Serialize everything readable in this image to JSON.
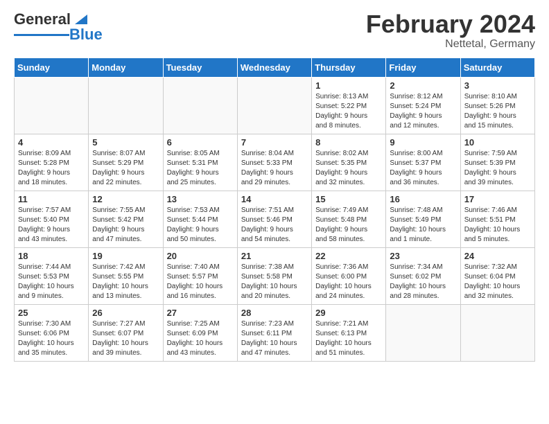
{
  "header": {
    "logo_general": "General",
    "logo_blue": "Blue",
    "month_title": "February 2024",
    "location": "Nettetal, Germany"
  },
  "days_of_week": [
    "Sunday",
    "Monday",
    "Tuesday",
    "Wednesday",
    "Thursday",
    "Friday",
    "Saturday"
  ],
  "weeks": [
    [
      {
        "day": "",
        "info": ""
      },
      {
        "day": "",
        "info": ""
      },
      {
        "day": "",
        "info": ""
      },
      {
        "day": "",
        "info": ""
      },
      {
        "day": "1",
        "info": "Sunrise: 8:13 AM\nSunset: 5:22 PM\nDaylight: 9 hours\nand 8 minutes."
      },
      {
        "day": "2",
        "info": "Sunrise: 8:12 AM\nSunset: 5:24 PM\nDaylight: 9 hours\nand 12 minutes."
      },
      {
        "day": "3",
        "info": "Sunrise: 8:10 AM\nSunset: 5:26 PM\nDaylight: 9 hours\nand 15 minutes."
      }
    ],
    [
      {
        "day": "4",
        "info": "Sunrise: 8:09 AM\nSunset: 5:28 PM\nDaylight: 9 hours\nand 18 minutes."
      },
      {
        "day": "5",
        "info": "Sunrise: 8:07 AM\nSunset: 5:29 PM\nDaylight: 9 hours\nand 22 minutes."
      },
      {
        "day": "6",
        "info": "Sunrise: 8:05 AM\nSunset: 5:31 PM\nDaylight: 9 hours\nand 25 minutes."
      },
      {
        "day": "7",
        "info": "Sunrise: 8:04 AM\nSunset: 5:33 PM\nDaylight: 9 hours\nand 29 minutes."
      },
      {
        "day": "8",
        "info": "Sunrise: 8:02 AM\nSunset: 5:35 PM\nDaylight: 9 hours\nand 32 minutes."
      },
      {
        "day": "9",
        "info": "Sunrise: 8:00 AM\nSunset: 5:37 PM\nDaylight: 9 hours\nand 36 minutes."
      },
      {
        "day": "10",
        "info": "Sunrise: 7:59 AM\nSunset: 5:39 PM\nDaylight: 9 hours\nand 39 minutes."
      }
    ],
    [
      {
        "day": "11",
        "info": "Sunrise: 7:57 AM\nSunset: 5:40 PM\nDaylight: 9 hours\nand 43 minutes."
      },
      {
        "day": "12",
        "info": "Sunrise: 7:55 AM\nSunset: 5:42 PM\nDaylight: 9 hours\nand 47 minutes."
      },
      {
        "day": "13",
        "info": "Sunrise: 7:53 AM\nSunset: 5:44 PM\nDaylight: 9 hours\nand 50 minutes."
      },
      {
        "day": "14",
        "info": "Sunrise: 7:51 AM\nSunset: 5:46 PM\nDaylight: 9 hours\nand 54 minutes."
      },
      {
        "day": "15",
        "info": "Sunrise: 7:49 AM\nSunset: 5:48 PM\nDaylight: 9 hours\nand 58 minutes."
      },
      {
        "day": "16",
        "info": "Sunrise: 7:48 AM\nSunset: 5:49 PM\nDaylight: 10 hours\nand 1 minute."
      },
      {
        "day": "17",
        "info": "Sunrise: 7:46 AM\nSunset: 5:51 PM\nDaylight: 10 hours\nand 5 minutes."
      }
    ],
    [
      {
        "day": "18",
        "info": "Sunrise: 7:44 AM\nSunset: 5:53 PM\nDaylight: 10 hours\nand 9 minutes."
      },
      {
        "day": "19",
        "info": "Sunrise: 7:42 AM\nSunset: 5:55 PM\nDaylight: 10 hours\nand 13 minutes."
      },
      {
        "day": "20",
        "info": "Sunrise: 7:40 AM\nSunset: 5:57 PM\nDaylight: 10 hours\nand 16 minutes."
      },
      {
        "day": "21",
        "info": "Sunrise: 7:38 AM\nSunset: 5:58 PM\nDaylight: 10 hours\nand 20 minutes."
      },
      {
        "day": "22",
        "info": "Sunrise: 7:36 AM\nSunset: 6:00 PM\nDaylight: 10 hours\nand 24 minutes."
      },
      {
        "day": "23",
        "info": "Sunrise: 7:34 AM\nSunset: 6:02 PM\nDaylight: 10 hours\nand 28 minutes."
      },
      {
        "day": "24",
        "info": "Sunrise: 7:32 AM\nSunset: 6:04 PM\nDaylight: 10 hours\nand 32 minutes."
      }
    ],
    [
      {
        "day": "25",
        "info": "Sunrise: 7:30 AM\nSunset: 6:06 PM\nDaylight: 10 hours\nand 35 minutes."
      },
      {
        "day": "26",
        "info": "Sunrise: 7:27 AM\nSunset: 6:07 PM\nDaylight: 10 hours\nand 39 minutes."
      },
      {
        "day": "27",
        "info": "Sunrise: 7:25 AM\nSunset: 6:09 PM\nDaylight: 10 hours\nand 43 minutes."
      },
      {
        "day": "28",
        "info": "Sunrise: 7:23 AM\nSunset: 6:11 PM\nDaylight: 10 hours\nand 47 minutes."
      },
      {
        "day": "29",
        "info": "Sunrise: 7:21 AM\nSunset: 6:13 PM\nDaylight: 10 hours\nand 51 minutes."
      },
      {
        "day": "",
        "info": ""
      },
      {
        "day": "",
        "info": ""
      }
    ]
  ]
}
